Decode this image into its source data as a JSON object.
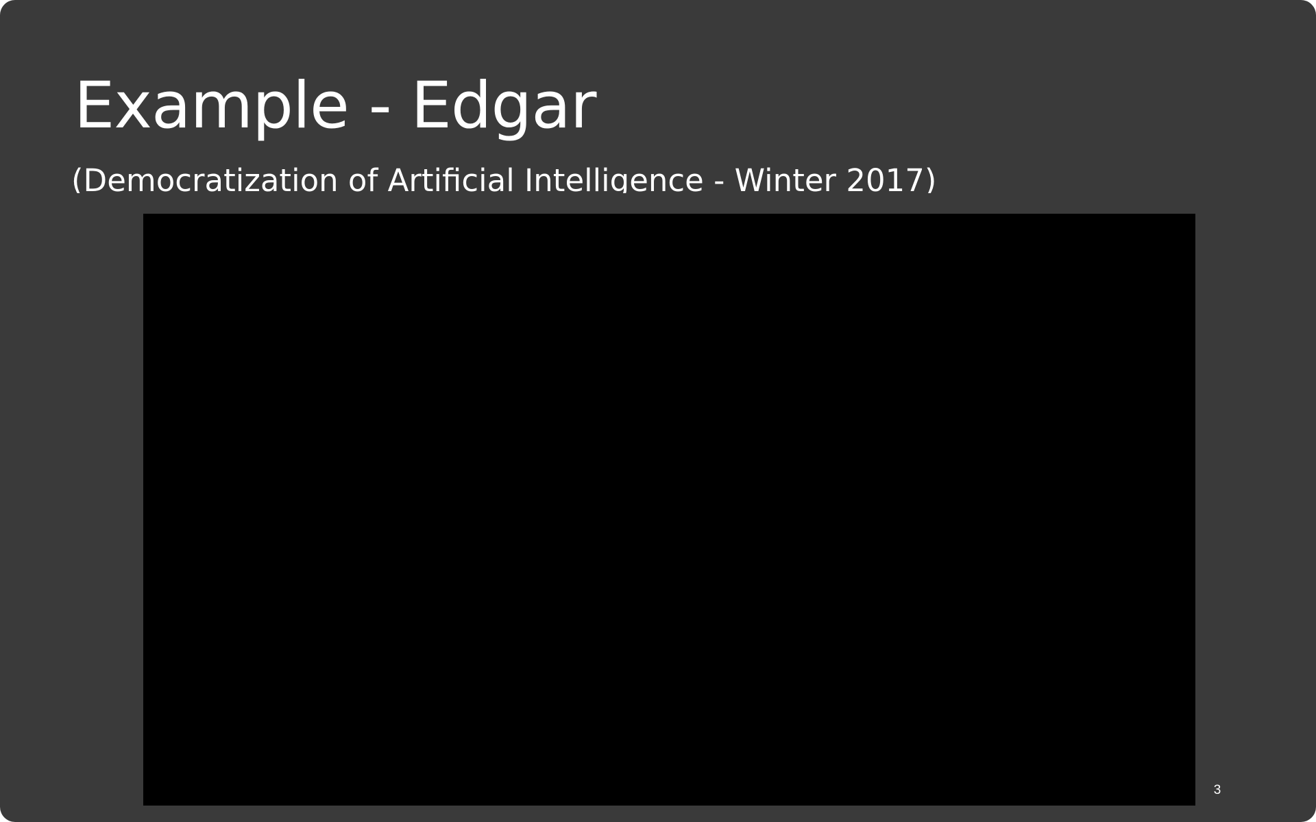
{
  "slide": {
    "title": "Example - Edgar",
    "subtitle": "(Democratization of Artificial Intelligence - Winter 2017)",
    "page_number": "3"
  },
  "colors": {
    "background": "#3a3a3a",
    "text": "#ffffff",
    "media": "#000000"
  }
}
